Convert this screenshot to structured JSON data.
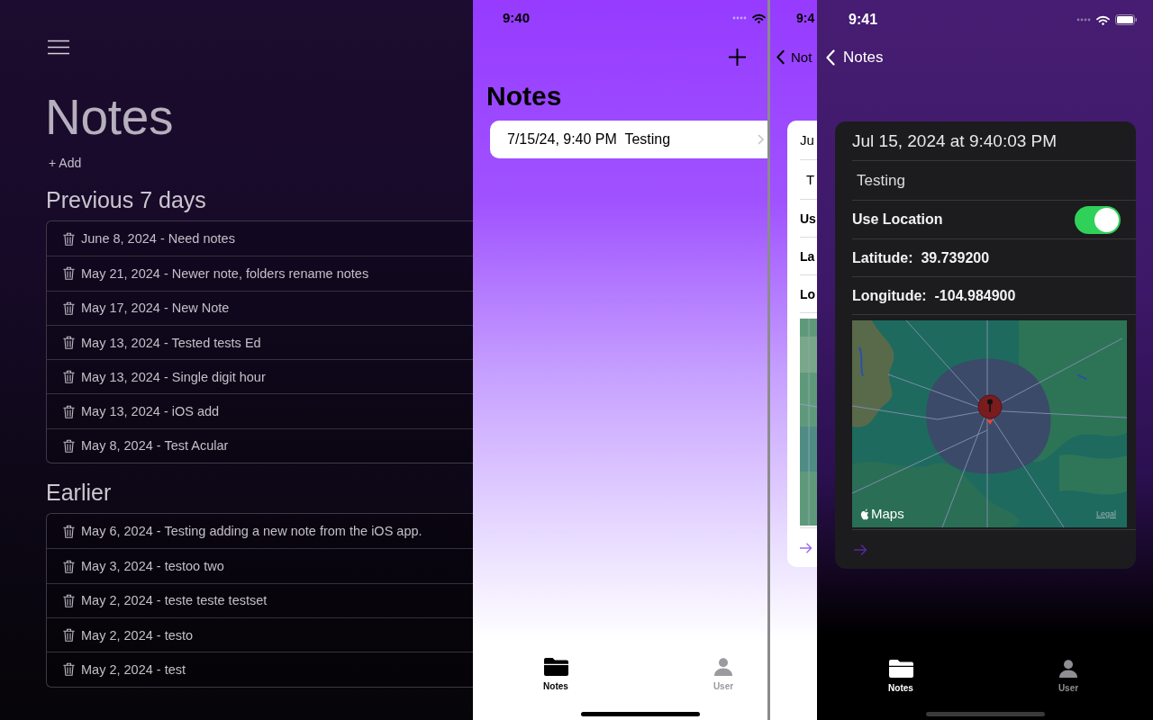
{
  "web_app": {
    "title": "Notes",
    "add_link": "+ Add",
    "sections": [
      {
        "heading": "Previous 7 days",
        "notes": [
          "June 8, 2024 - Need notes",
          "May 21, 2024 - Newer note, folders rename notes",
          "May 17, 2024 - New Note",
          "May 13, 2024 - Tested tests Ed",
          "May 13, 2024 - Single digit hour",
          "May 13, 2024 - iOS add",
          "May 8, 2024 - Test Acular"
        ]
      },
      {
        "heading": "Earlier",
        "notes": [
          "May 6, 2024 - Testing adding a new note from the iOS app.",
          "May 3, 2024 - testoo two",
          "May 2, 2024 - teste teste testset",
          "May 2, 2024 - testo",
          "May 2, 2024 - test"
        ]
      }
    ]
  },
  "phone_list": {
    "status_time": "9:40",
    "title": "Notes",
    "notes": [
      "7/15/24, 9:40 PM  Testing"
    ],
    "tabs": [
      {
        "label": "Notes",
        "selected": true
      },
      {
        "label": "User",
        "selected": false
      }
    ]
  },
  "phone_detail_behind": {
    "status_time": "9:4",
    "back_label": "Not",
    "rows": [
      {
        "kind": "date",
        "text": "Ju"
      },
      {
        "kind": "field",
        "text": "T"
      },
      {
        "kind": "label",
        "text": "Us"
      },
      {
        "kind": "label",
        "text": "La"
      },
      {
        "kind": "label",
        "text": "Lo"
      },
      {
        "kind": "map"
      },
      {
        "kind": "arrow"
      }
    ]
  },
  "phone_detail": {
    "status_time": "9:41",
    "back_label": "Notes",
    "rows": [
      {
        "kind": "date",
        "text": "Jul 15, 2024 at 9:40:03 PM"
      },
      {
        "kind": "field",
        "text": "Testing"
      },
      {
        "kind": "toggle",
        "text": "Use Location",
        "on": true
      },
      {
        "kind": "label",
        "text": "Latitude:  39.739200"
      },
      {
        "kind": "label",
        "text": "Longitude:  -104.984900"
      },
      {
        "kind": "map",
        "attribution": "Maps",
        "legal": "Legal"
      },
      {
        "kind": "arrow"
      }
    ],
    "tabs": [
      {
        "label": "Notes",
        "selected": true
      },
      {
        "label": "User",
        "selected": false
      }
    ]
  }
}
